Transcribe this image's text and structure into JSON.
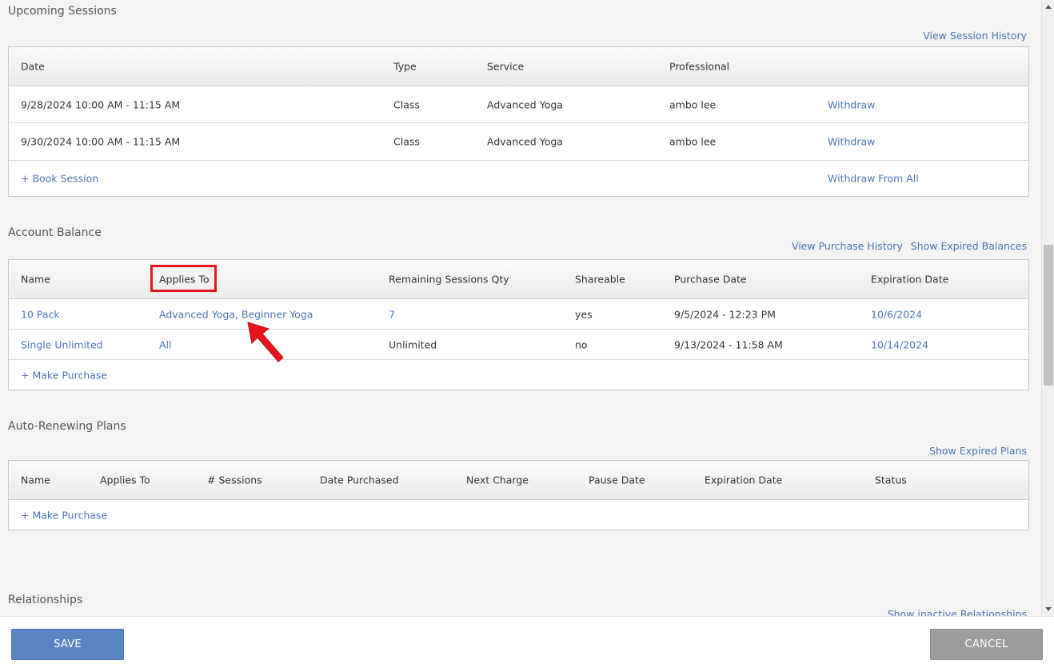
{
  "upcoming": {
    "title": "Upcoming Sessions",
    "history_link": "View Session History",
    "headers": {
      "date": "Date",
      "type": "Type",
      "service": "Service",
      "professional": "Professional"
    },
    "rows": [
      {
        "date": "9/28/2024 10:00 AM - 11:15 AM",
        "type": "Class",
        "service": "Advanced Yoga",
        "professional": "ambo lee",
        "action": "Withdraw"
      },
      {
        "date": "9/30/2024 10:00 AM - 11:15 AM",
        "type": "Class",
        "service": "Advanced Yoga",
        "professional": "ambo lee",
        "action": "Withdraw"
      }
    ],
    "book_link": "+ Book Session",
    "withdraw_all": "Withdraw From All"
  },
  "balance": {
    "title": "Account Balance",
    "purchase_history_link": "View Purchase History",
    "expired_balances_link": "Show Expired Balances",
    "headers": {
      "name": "Name",
      "applies_to": "Applies To",
      "remaining": "Remaining Sessions Qty",
      "shareable": "Shareable",
      "purchase_date": "Purchase Date",
      "expiration": "Expiration Date"
    },
    "rows": [
      {
        "name": "10 Pack",
        "applies_to": "Advanced Yoga, Beginner Yoga",
        "remaining": "7",
        "shareable": "yes",
        "purchase_date": "9/5/2024 - 12:23 PM",
        "expiration": "10/6/2024"
      },
      {
        "name": "Single Unlimited",
        "applies_to": "All",
        "remaining": "Unlimited",
        "shareable": "no",
        "purchase_date": "9/13/2024 - 11:58 AM",
        "expiration": "10/14/2024"
      }
    ],
    "make_purchase": "+ Make Purchase"
  },
  "plans": {
    "title": "Auto-Renewing Plans",
    "expired_link": "Show Expired Plans",
    "headers": {
      "name": "Name",
      "applies_to": "Applies To",
      "sessions": "# Sessions",
      "date_purchased": "Date Purchased",
      "next_charge": "Next Charge",
      "pause_date": "Pause Date",
      "expiration": "Expiration Date",
      "status": "Status"
    },
    "make_purchase": "+ Make Purchase"
  },
  "relationships": {
    "title": "Relationships",
    "inactive_link": "Show inactive Relationships"
  },
  "footer": {
    "save": "SAVE",
    "cancel": "CANCEL"
  },
  "colors": {
    "link": "#4a74b5",
    "save_button": "#5b84c4",
    "cancel_button": "#9c9c9c",
    "highlight": "#e8141c"
  }
}
